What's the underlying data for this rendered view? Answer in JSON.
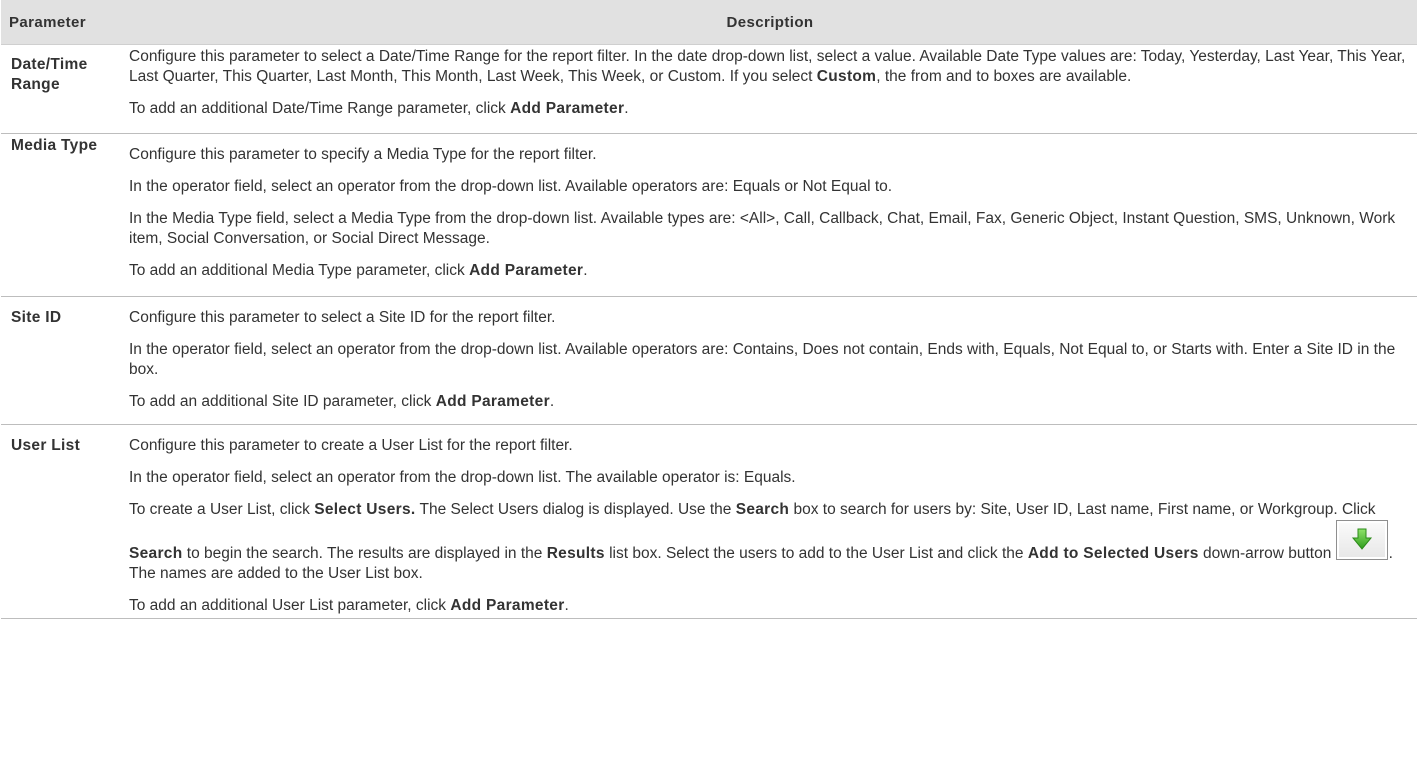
{
  "table": {
    "headers": {
      "parameter": "Parameter",
      "description": "Description"
    },
    "rows": [
      {
        "param": "Date/Time Range",
        "p1": "Configure this parameter to select a Date/Time Range for the report filter. In the date drop-down list, select a value. Available Date Type values are: Today, Yesterday, Last Year, This Year, Last Quarter, This Quarter, Last Month, This Month, Last Week, This Week, or Custom. If you select ",
        "p1_bold": "Custom",
        "p1_end": ", the from and to boxes are available.",
        "p2": "To add an additional Date/Time Range parameter, click ",
        "p2_bold": "Add Parameter",
        "p2_end": "."
      },
      {
        "param": "Media Type",
        "p1": "Configure this parameter to specify a Media Type for the report filter.",
        "p2": "In the operator field, select an operator from the drop-down list. Available operators are: Equals or Not Equal to.",
        "p3": "In the Media Type field, select a Media Type from the drop-down list. Available types are: <All>, Call, Callback, Chat, Email, Fax, Generic Object, Instant Question, SMS, Unknown, Work item, Social Conversation, or Social Direct Message.",
        "p4": "To add an additional Media Type parameter, click ",
        "p4_bold": "Add Parameter",
        "p4_end": "."
      },
      {
        "param": "Site ID",
        "p1": "Configure this parameter to select a Site ID for the report filter.",
        "p2": "In the operator field, select an operator from the drop-down list. Available operators are: Contains, Does not contain, Ends with, Equals, Not Equal to, or Starts with. Enter a Site ID in the box.",
        "p3": "To add an additional Site ID parameter, click ",
        "p3_bold": "Add Parameter",
        "p3_end": "."
      },
      {
        "param": "User List",
        "p1": "Configure this parameter to create a User List for the report filter.",
        "p2": "In the operator field, select an operator from the drop-down list. The available operator is: Equals.",
        "p3_a": "To create a User List, click ",
        "p3_b": "Select Users.",
        "p3_c": " The Select Users dialog is displayed. Use the ",
        "p3_d": "Search",
        "p3_e": " box to search for users by: Site, User ID, Last name, First name, or Workgroup. Click ",
        "p3_f": "Search",
        "p3_g": " to begin the search. The results are displayed in the ",
        "p3_h": "Results",
        "p3_i": " list box. Select the users to add to the User List and click the ",
        "p3_j": "Add to Selected Users",
        "p3_k": " down-arrow button ",
        "p3_l": ". The names are added to the User List box.",
        "p4": "To add an additional User List parameter, click ",
        "p4_bold": "Add Parameter",
        "p4_end": "."
      }
    ]
  },
  "icons": {
    "add_button": "green-down-arrow-icon"
  },
  "colors": {
    "header_bg": "#e1e1e1",
    "arrow_green": "#4cbb2c"
  }
}
